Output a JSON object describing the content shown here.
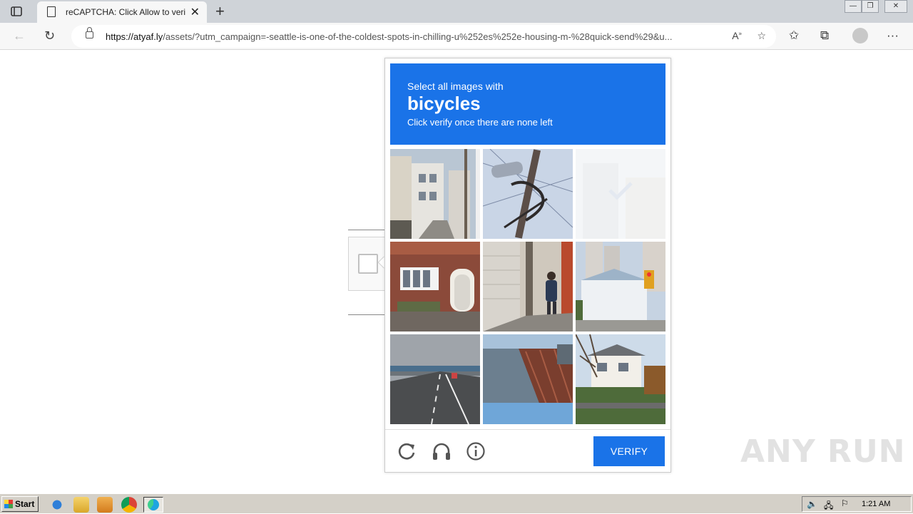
{
  "browser": {
    "tab_title": "reCAPTCHA: Click Allow to veri",
    "url_host": "https://atyaf.ly",
    "url_path": "/assets/?utm_campaign=-seattle-is-one-of-the-coldest-spots-in-chilling-u%252es%252e-housing-m-%28quick-send%29&u..."
  },
  "captcha": {
    "prompt_line1": "Select all images with",
    "target_word": "bicycles",
    "prompt_line3": "Click verify once there are none left",
    "verify_label": "VERIFY",
    "tiles": [
      {
        "id": 1,
        "scene": "narrow street with houses and utility pole",
        "faded": false
      },
      {
        "id": 2,
        "scene": "street lamp and power lines",
        "faded": false
      },
      {
        "id": 3,
        "scene": "selected tile fading out",
        "faded": true
      },
      {
        "id": 4,
        "scene": "brick house with white windows",
        "faded": false
      },
      {
        "id": 5,
        "scene": "man walking beside building",
        "faded": false
      },
      {
        "id": 6,
        "scene": "towers behind white building with traffic light",
        "faded": false
      },
      {
        "id": 7,
        "scene": "highway under bridge",
        "faded": false
      },
      {
        "id": 8,
        "scene": "bridge railing over water",
        "faded": false
      },
      {
        "id": 9,
        "scene": "house behind bare tree",
        "faded": false
      }
    ]
  },
  "watermark": "ANY RUN",
  "taskbar": {
    "start_label": "Start",
    "clock": "1:21 AM"
  },
  "colors": {
    "accent": "#1a73e8",
    "tabbar": "#cfd3d8",
    "taskbar": "#d4d0c8"
  }
}
